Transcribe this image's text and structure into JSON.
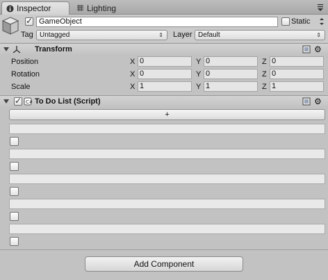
{
  "tabs": [
    {
      "label": "Inspector",
      "icon": "info-icon"
    },
    {
      "label": "Lighting",
      "icon": "lighting-icon"
    }
  ],
  "header": {
    "active": true,
    "name": "GameObject",
    "static_label": "Static",
    "static": false,
    "tag_label": "Tag",
    "tag_value": "Untagged",
    "layer_label": "Layer",
    "layer_value": "Default"
  },
  "transform": {
    "title": "Transform",
    "rows": [
      {
        "label": "Position",
        "x": "0",
        "y": "0",
        "z": "0"
      },
      {
        "label": "Rotation",
        "x": "0",
        "y": "0",
        "z": "0"
      },
      {
        "label": "Scale",
        "x": "1",
        "y": "1",
        "z": "1"
      }
    ],
    "axes": {
      "x": "X",
      "y": "Y",
      "z": "Z"
    }
  },
  "todo": {
    "title": "To Do List (Script)",
    "add_label": "+",
    "items": [
      {
        "text": "",
        "done": false
      },
      {
        "text": "",
        "done": false
      },
      {
        "text": "",
        "done": false
      },
      {
        "text": "",
        "done": false
      },
      {
        "text": "",
        "done": false
      }
    ]
  },
  "add_component_label": "Add Component",
  "colors": {
    "background": "#c2c2c2",
    "field": "#e5e5e5"
  }
}
